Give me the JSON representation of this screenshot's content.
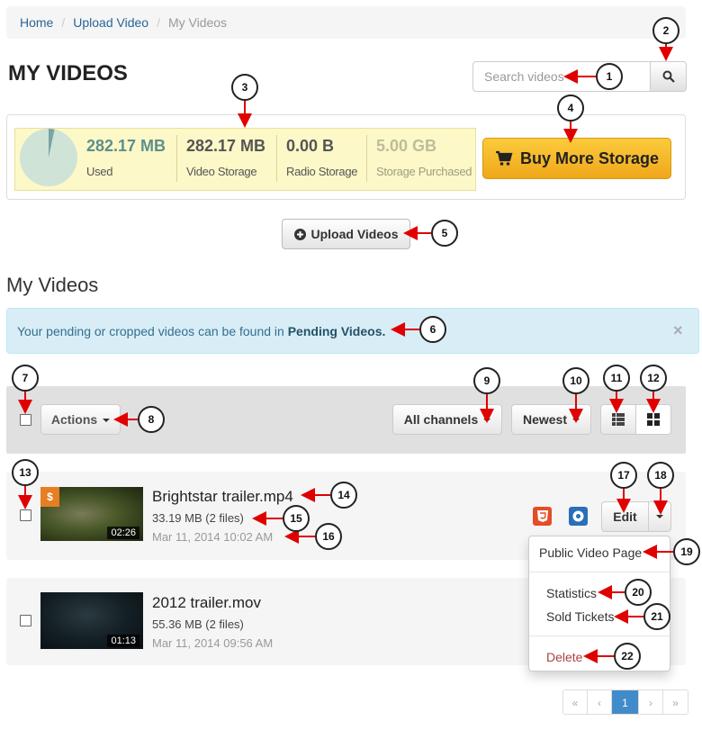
{
  "breadcrumb": {
    "home": "Home",
    "upload": "Upload Video",
    "current": "My Videos",
    "separator": "/"
  },
  "page_title": "MY VIDEOS",
  "search": {
    "placeholder": "Search videos"
  },
  "storage": {
    "used_value": "282.17 MB",
    "used_label": "Used",
    "video_value": "282.17 MB",
    "video_label": "Video Storage",
    "radio_value": "0.00 B",
    "radio_label": "Radio Storage",
    "purchased_value": "5.00 GB",
    "purchased_label": "Storage Purchased",
    "used_fraction": 0.033,
    "buy_label": "Buy More Storage"
  },
  "upload_label": "Upload Videos",
  "section_title": "My Videos",
  "alert": {
    "text": "Your pending or cropped videos can be found in ",
    "link": "Pending Videos.",
    "close": "×"
  },
  "toolbar": {
    "actions": "Actions",
    "channels": "All channels",
    "sort": "Newest"
  },
  "videos": [
    {
      "title": "Brightstar trailer.mp4",
      "size": "33.19 MB (2 files)",
      "date": "Mar 11, 2014 10:02 AM",
      "duration": "02:26",
      "paid_badge": "$",
      "edit": "Edit"
    },
    {
      "title": "2012 trailer.mov",
      "size": "55.36 MB (2 files)",
      "date": "Mar 11, 2014 09:56 AM",
      "duration": "01:13"
    }
  ],
  "dropdown": {
    "public_page": "Public Video Page",
    "statistics": "Statistics",
    "sold_tickets": "Sold Tickets",
    "delete": "Delete"
  },
  "pagination": {
    "first": "«",
    "prev": "‹",
    "current": "1",
    "next": "›",
    "last": "»"
  },
  "callouts": [
    "1",
    "2",
    "3",
    "4",
    "5",
    "6",
    "7",
    "8",
    "9",
    "10",
    "11",
    "12",
    "13",
    "14",
    "15",
    "16",
    "17",
    "18",
    "19",
    "20",
    "21",
    "22"
  ],
  "colors": {
    "accent": "#428bca",
    "buy": "#f0a71a",
    "alert_bg": "#d9edf7",
    "delete": "#a94442",
    "arrow": "#e00000"
  }
}
